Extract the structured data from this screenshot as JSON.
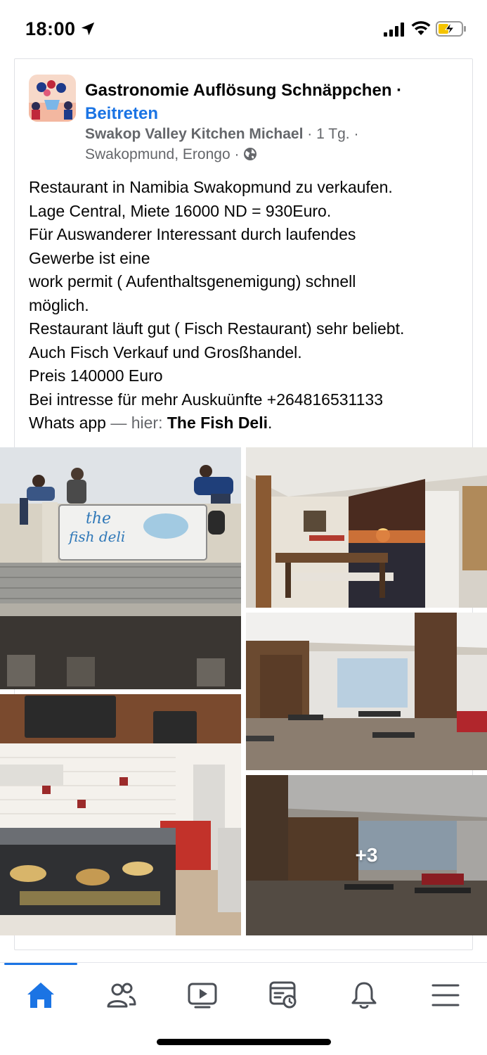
{
  "status_bar": {
    "time": "18:00"
  },
  "post": {
    "group_name": "Gastronomie Auflösung Schnäppchen",
    "separator": " · ",
    "join_label": "Beitreten",
    "author": "Swakop Valley Kitchen Michael",
    "time_ago": "1 Tg.",
    "location": "Swakopmund, Erongo",
    "meta_separator": " · ",
    "body_lines": [
      "Restaurant in Namibia Swakopmund zu verkaufen.",
      "Lage Central, Miete 16000 ND = 930Euro.",
      "Für Auswanderer Interessant durch laufendes",
      "Gewerbe ist eine",
      "work permit ( Aufenthaltsgenemigung) schnell",
      "möglich.",
      "Restaurant läuft gut ( Fisch Restaurant) sehr beliebt.",
      "Auch Fisch Verkauf und Grosßhandel.",
      "Preis 140000 Euro",
      "Bei intresse für mehr Auskuünfte +264816531133"
    ],
    "last_line_prefix": "Whats app",
    "last_line_dash": " — hier: ",
    "place_name": "The Fish Deli",
    "last_line_suffix": ".",
    "sign_text_top": "the",
    "sign_text_bottom": "fish deli",
    "more_photos": "+3"
  },
  "nav": {
    "items": [
      "home-icon",
      "friends-icon",
      "video-icon",
      "feeds-icon",
      "notifications-icon",
      "menu-icon"
    ],
    "active_color": "#1b74e4"
  }
}
